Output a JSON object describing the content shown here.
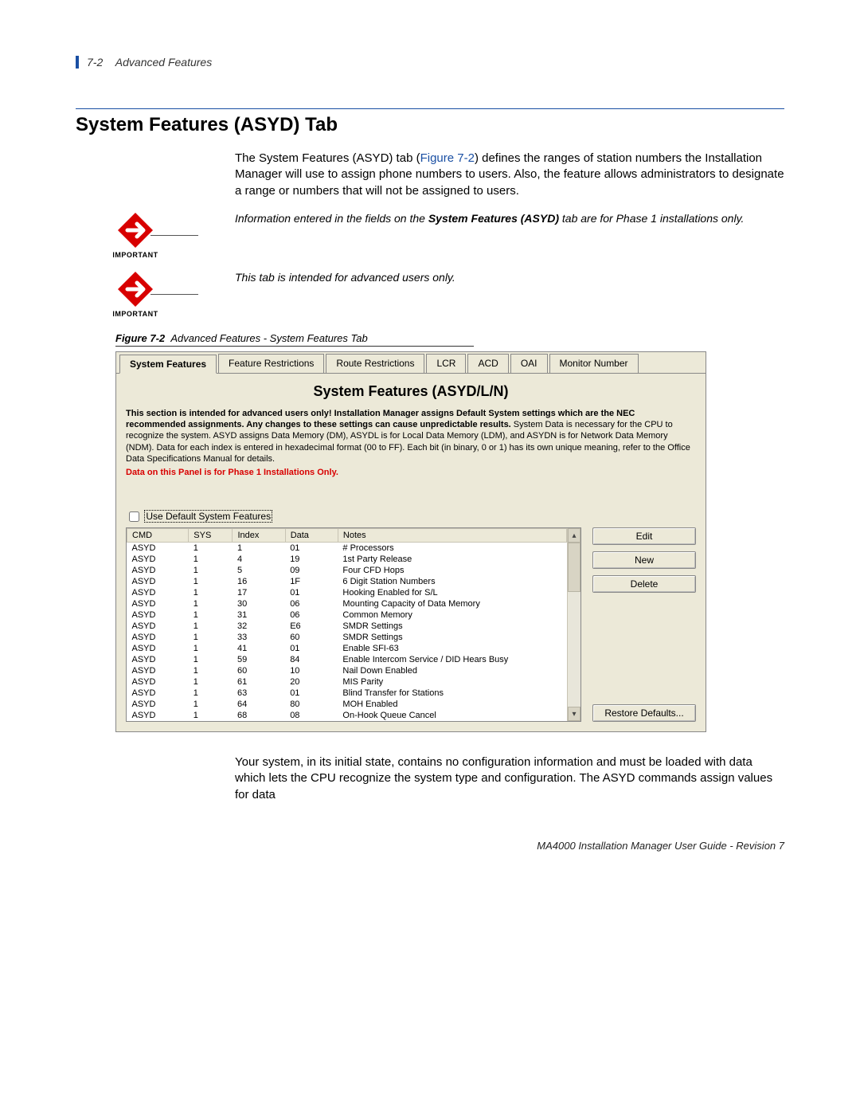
{
  "header": {
    "page_ref": "7-2",
    "section": "Advanced Features"
  },
  "title": "System Features (ASYD) Tab",
  "intro": {
    "before_ref": "The System Features (ASYD) tab (",
    "figref": "Figure 7-2",
    "after_ref": ") defines the ranges of station numbers the Installation Manager will use to assign phone numbers to users. Also, the feature allows administrators to designate a range or numbers that will not be assigned to users."
  },
  "important_label": "IMPORTANT",
  "note1": {
    "prefix": "Information entered in the fields on the ",
    "bold": "System Features (ASYD)",
    "suffix": " tab are for Phase 1 installations only."
  },
  "note2": "This tab is intended for advanced users only.",
  "figure": {
    "label": "Figure 7-2",
    "title": "Advanced Features - System Features Tab"
  },
  "tabs": [
    "System Features",
    "Feature Restrictions",
    "Route Restrictions",
    "LCR",
    "ACD",
    "OAI",
    "Monitor Number"
  ],
  "panel": {
    "title": "System Features (ASYD/L/N)",
    "desc_bold": "This section is intended for advanced users only! Installation Manager assigns Default System settings which are the NEC recommended assignments. Any changes to these settings can cause unpredictable results.",
    "desc_rest": " System Data is necessary for the CPU to recognize the system. ASYD assigns Data Memory (DM), ASYDL is for Local Data Memory (LDM), and ASYDN is for Network Data Memory (NDM). Data for each index is entered in hexadecimal format (00 to FF). Each bit (in binary, 0 or 1) has its own unique meaning, refer to the Office Data Specifications Manual for details.",
    "red": "Data on this Panel is for Phase 1 Installations Only.",
    "checkbox_label": "Use Default System Features",
    "columns": [
      "CMD",
      "SYS",
      "Index",
      "Data",
      "Notes"
    ],
    "buttons": {
      "edit": "Edit",
      "new": "New",
      "delete": "Delete",
      "restore": "Restore Defaults..."
    },
    "rows": [
      {
        "cmd": "ASYD",
        "sys": "1",
        "index": "1",
        "data": "01",
        "notes": "# Processors"
      },
      {
        "cmd": "ASYD",
        "sys": "1",
        "index": "4",
        "data": "19",
        "notes": "1st Party Release"
      },
      {
        "cmd": "ASYD",
        "sys": "1",
        "index": "5",
        "data": "09",
        "notes": "Four CFD Hops"
      },
      {
        "cmd": "ASYD",
        "sys": "1",
        "index": "16",
        "data": "1F",
        "notes": "6 Digit Station Numbers"
      },
      {
        "cmd": "ASYD",
        "sys": "1",
        "index": "17",
        "data": "01",
        "notes": "Hooking Enabled for S/L"
      },
      {
        "cmd": "ASYD",
        "sys": "1",
        "index": "30",
        "data": "06",
        "notes": "Mounting Capacity of Data Memory"
      },
      {
        "cmd": "ASYD",
        "sys": "1",
        "index": "31",
        "data": "06",
        "notes": "Common Memory"
      },
      {
        "cmd": "ASYD",
        "sys": "1",
        "index": "32",
        "data": "E6",
        "notes": "SMDR Settings"
      },
      {
        "cmd": "ASYD",
        "sys": "1",
        "index": "33",
        "data": "60",
        "notes": "SMDR Settings"
      },
      {
        "cmd": "ASYD",
        "sys": "1",
        "index": "41",
        "data": "01",
        "notes": "Enable SFI-63"
      },
      {
        "cmd": "ASYD",
        "sys": "1",
        "index": "59",
        "data": "84",
        "notes": "Enable Intercom Service / DID Hears Busy"
      },
      {
        "cmd": "ASYD",
        "sys": "1",
        "index": "60",
        "data": "10",
        "notes": "Nail Down Enabled"
      },
      {
        "cmd": "ASYD",
        "sys": "1",
        "index": "61",
        "data": "20",
        "notes": "MIS Parity"
      },
      {
        "cmd": "ASYD",
        "sys": "1",
        "index": "63",
        "data": "01",
        "notes": "Blind Transfer for Stations"
      },
      {
        "cmd": "ASYD",
        "sys": "1",
        "index": "64",
        "data": "80",
        "notes": "MOH Enabled"
      },
      {
        "cmd": "ASYD",
        "sys": "1",
        "index": "68",
        "data": "08",
        "notes": "On-Hook Queue Cancel"
      }
    ]
  },
  "below_figure": "Your system, in its initial state, contains no configuration information and must be loaded with data which lets the CPU recognize the system type and configuration. The ASYD commands assign values for data",
  "footer": "MA4000 Installation Manager User Guide - Revision 7"
}
